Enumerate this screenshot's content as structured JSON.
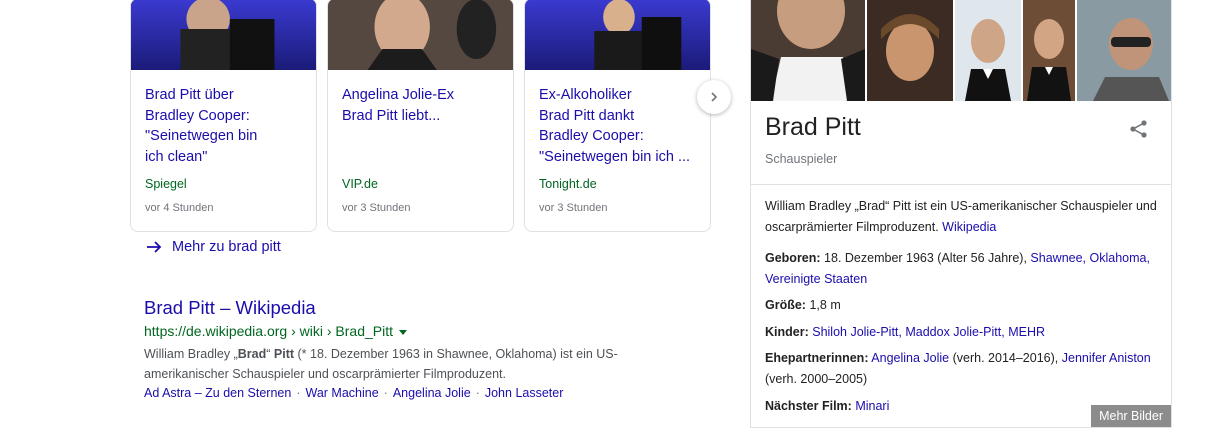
{
  "news": {
    "cards": [
      {
        "title_lines": [
          "Brad Pitt über",
          "Bradley Cooper:",
          "\"Seinetwegen bin",
          "ich clean\""
        ],
        "source": "Spiegel",
        "time": "vor 4 Stunden"
      },
      {
        "title_lines": [
          "Angelina Jolie-Ex",
          "Brad Pitt liebt..."
        ],
        "source": "VIP.de",
        "time": "vor 3 Stunden"
      },
      {
        "title_lines": [
          "Ex-Alkoholiker",
          "Brad Pitt dankt",
          "Bradley Cooper:",
          "\"Seinetwegen bin ich ..."
        ],
        "source": "Tonight.de",
        "time": "vor 3 Stunden"
      }
    ],
    "more_label": "Mehr zu brad pitt"
  },
  "result": {
    "title": "Brad Pitt – Wikipedia",
    "url": "https://de.wikipedia.org › wiki › Brad_Pitt",
    "snippet_pre": "William Bradley „",
    "snippet_b1": "Brad",
    "snippet_mid": "“ ",
    "snippet_b2": "Pitt",
    "snippet_post": " (* 18. Dezember 1963 in Shawnee, Oklahoma) ist ein US-amerikanischer Schauspieler und oscarprämierter Filmproduzent.",
    "sitelinks": [
      "Ad Astra – Zu den Sternen",
      "War Machine",
      "Angelina Jolie",
      "John Lasseter"
    ],
    "sitelink_sep": "·"
  },
  "panel": {
    "title": "Brad Pitt",
    "subtitle": "Schauspieler",
    "more_images": "Mehr Bilder",
    "description": "William Bradley „Brad“ Pitt ist ein US-amerikanischer Schauspieler und oscarprämierter Filmproduzent.",
    "description_link": "Wikipedia",
    "born_label": "Geboren:",
    "born_value": "18. Dezember 1963 (Alter 56 Jahre),",
    "born_link1": "Shawnee,",
    "born_link2": "Oklahoma,",
    "born_link3": "Vereinigte Staaten",
    "height_label": "Größe:",
    "height_value": "1,8 m",
    "children_label": "Kinder:",
    "children_link1": "Shiloh Jolie-Pitt,",
    "children_link2": "Maddox Jolie-Pitt,",
    "children_link3": "MEHR",
    "partners_label": "Ehepartnerinnen:",
    "partners_link1": "Angelina Jolie",
    "partners_text1": "(verh. 2014–2016),",
    "partners_link2": "Jennifer Aniston",
    "partners_text2": "(verh. 2000–2005)",
    "film_label": "Nächster Film:",
    "film_link": "Minari"
  },
  "colors": {
    "link": "#1a0dab",
    "url_green": "#006621",
    "muted": "#70757a"
  }
}
